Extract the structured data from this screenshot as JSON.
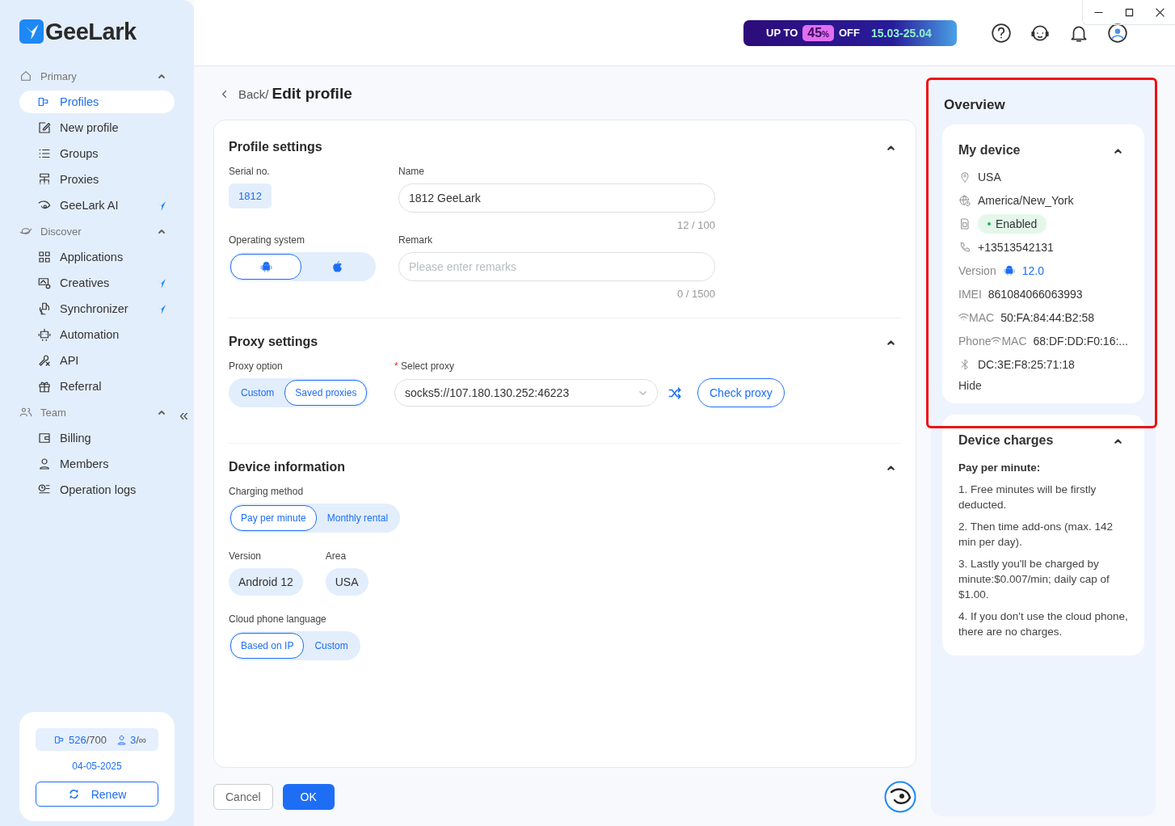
{
  "logo": {
    "text": "GeeLark"
  },
  "sidebar": {
    "sections": [
      {
        "title": "Primary",
        "expanded": true,
        "items": [
          {
            "label": "Profiles",
            "selected": true,
            "new": false
          },
          {
            "label": "New profile",
            "selected": false,
            "new": false
          },
          {
            "label": "Groups",
            "selected": false,
            "new": false
          },
          {
            "label": "Proxies",
            "selected": false,
            "new": false
          },
          {
            "label": "GeeLark AI",
            "selected": false,
            "new": true
          }
        ]
      },
      {
        "title": "Discover",
        "expanded": true,
        "items": [
          {
            "label": "Applications",
            "selected": false,
            "new": false
          },
          {
            "label": "Creatives",
            "selected": false,
            "new": true
          },
          {
            "label": "Synchronizer",
            "selected": false,
            "new": true
          },
          {
            "label": "Automation",
            "selected": false,
            "new": false
          },
          {
            "label": "API",
            "selected": false,
            "new": false
          },
          {
            "label": "Referral",
            "selected": false,
            "new": false
          }
        ]
      },
      {
        "title": "Team",
        "expanded": true,
        "items": [
          {
            "label": "Billing",
            "selected": false,
            "new": false
          },
          {
            "label": "Members",
            "selected": false,
            "new": false
          },
          {
            "label": "Operation logs",
            "selected": false,
            "new": false
          }
        ]
      }
    ],
    "collapse": "«",
    "plan": {
      "profiles": "526",
      "profiles_max": "/700",
      "members": "3",
      "members_max": "/∞",
      "date": "04-05-2025",
      "renew": "Renew"
    }
  },
  "promo": {
    "prefix": "UP TO",
    "percent": "45",
    "percent_sign": "%",
    "suffix": "OFF",
    "dates": "15.03-25.04"
  },
  "page": {
    "back": "Back/",
    "title": "Edit profile"
  },
  "profile_settings": {
    "title": "Profile settings",
    "expanded": true,
    "serial_label": "Serial no.",
    "serial": "1812",
    "name_label": "Name",
    "name_value": "1812 GeeLark",
    "name_count": "12 / 100",
    "os_label": "Operating system",
    "os_options": [
      {
        "kind": "android",
        "selected": true
      },
      {
        "kind": "apple",
        "selected": false
      }
    ],
    "remark_label": "Remark",
    "remark_placeholder": "Please enter remarks",
    "remark_count": "0 / 1500"
  },
  "proxy_settings": {
    "title": "Proxy settings",
    "expanded": true,
    "option_label": "Proxy option",
    "options": [
      {
        "label": "Custom",
        "selected": false
      },
      {
        "label": "Saved proxies",
        "selected": true
      }
    ],
    "required_mark": "*",
    "select_label": "Select proxy",
    "select_value": "socks5://107.180.130.252:46223",
    "check": "Check proxy"
  },
  "device_information": {
    "title": "Device information",
    "expanded": true,
    "charging_label": "Charging method",
    "charging": [
      {
        "label": "Pay per minute",
        "selected": true
      },
      {
        "label": "Monthly rental",
        "selected": false
      }
    ],
    "version_label": "Version",
    "version": "Android 12",
    "area_label": "Area",
    "area": "USA",
    "language_label": "Cloud phone language",
    "language": [
      {
        "label": "Based on IP",
        "selected": true
      },
      {
        "label": "Custom",
        "selected": false
      }
    ]
  },
  "actions": {
    "cancel": "Cancel",
    "ok": "OK"
  },
  "overview": {
    "title": "Overview",
    "highlighted": true,
    "my_device": {
      "title": "My device",
      "expanded": true,
      "location": "USA",
      "timezone": "America/New_York",
      "sim_status": "Enabled",
      "phone": "+13513542131",
      "version_label": "Version",
      "version": "12.0",
      "imei_label": "IMEI",
      "imei": "861084066063993",
      "mac_label": "MAC",
      "mac": "50:FA:84:44:B2:58",
      "phone_mac_label_1": "Phone",
      "phone_mac_label_2": "MAC",
      "phone_mac": "68:DF:DD:F0:16:...",
      "bluetooth": "DC:3E:F8:25:71:18",
      "hide": "Hide"
    },
    "charges": {
      "title": "Device charges",
      "expanded": true,
      "heading": "Pay per minute:",
      "rules": [
        "1. Free minutes will be firstly deducted.",
        "2. Then time add-ons (max. 142 min per day).",
        "3. Lastly you'll be charged by minute:$0.007/min; daily cap of $1.00.",
        "4. If you don't use the cloud phone, there are no charges."
      ]
    }
  }
}
